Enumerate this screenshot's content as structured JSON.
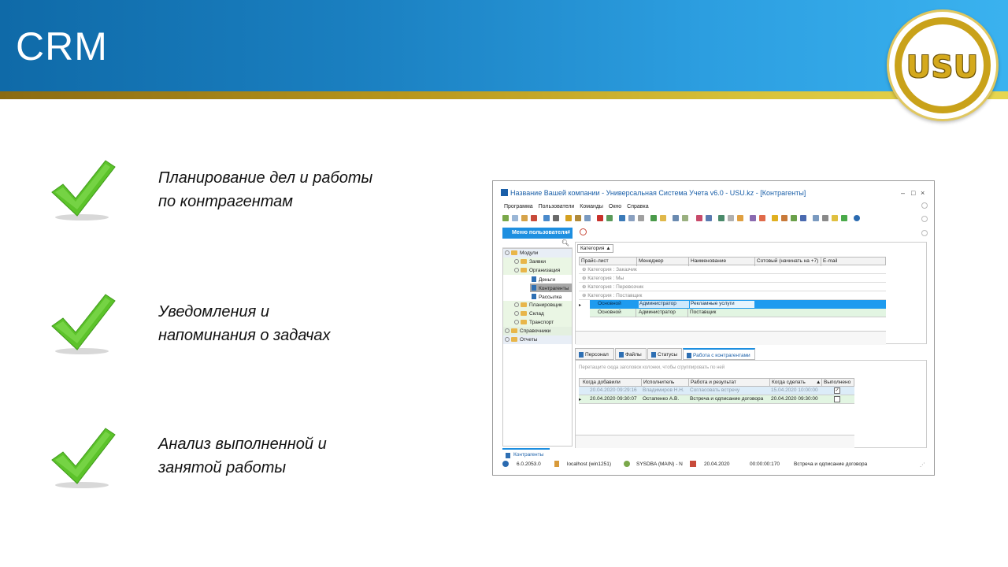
{
  "slide": {
    "title": "CRM",
    "logo_text": "USU",
    "features": [
      {
        "line1": "Планирование дел и работы",
        "line2": "по контрагентам"
      },
      {
        "line1": "Уведомления и",
        "line2": "напоминания о задачах"
      },
      {
        "line1": "Анализ выполненной и",
        "line2": "занятой работы"
      }
    ],
    "colors": {
      "header_start": "#0f6aa8",
      "header_end": "#3ab2ef",
      "stripe": "#c9a21a",
      "check": "#5cc32a",
      "logo_gold": "#d4a91c"
    }
  },
  "app": {
    "window_title": "Название Вашей компании - Универсальная Система Учета v6.0 - USU.kz - [Контрагенты]",
    "window_controls": [
      "–",
      "□",
      "×"
    ],
    "menu": [
      "Программа",
      "Пользователи",
      "Команды",
      "Окно",
      "Справка"
    ],
    "sidebar": {
      "header": "Меню пользователя",
      "pin": "#",
      "items": [
        {
          "label": "Модули",
          "level": 0
        },
        {
          "label": "Заявки",
          "level": 1
        },
        {
          "label": "Организация",
          "level": 1
        },
        {
          "label": "Деньги",
          "level": 2
        },
        {
          "label": "Контрагенты",
          "level": 2
        },
        {
          "label": "Рассылка",
          "level": 2
        },
        {
          "label": "Планировщик",
          "level": 1
        },
        {
          "label": "Склад",
          "level": 1
        },
        {
          "label": "Транспорт",
          "level": 1
        },
        {
          "label": "Справочники",
          "level": 0
        },
        {
          "label": "Отчеты",
          "level": 0
        }
      ]
    },
    "group_field": "Категория",
    "grid1": {
      "columns": [
        "Прайс-лист",
        "Менеджер",
        "Наименование",
        "Сотовый (начинать на +7)",
        "E-mail"
      ],
      "groups": [
        "Категория : Заказчик",
        "Категория : Мы",
        "Категория : Перевозчик",
        "Категория : Поставщик"
      ],
      "rows": [
        [
          "Основной",
          "Администратор",
          "Рекламные услуги",
          "",
          ""
        ],
        [
          "Основной",
          "Администратор",
          "Поставщик",
          "",
          ""
        ]
      ]
    },
    "tabs": [
      "Персонал",
      "Файлы",
      "Статусы",
      "Работа с контрагентами"
    ],
    "grid2": {
      "group_hint": "Перетащите сюда заголовок колонки, чтобы сгруппировать по ней",
      "columns": [
        "Когда добавили",
        "Исполнитель",
        "Работа и результат",
        "Когда сделать",
        "Выполнено"
      ],
      "rows": [
        [
          "20.04.2020 09:29:16",
          "Владимиров Н.Н.",
          "Согласовать встречу",
          "15.04.2020 10:00:00",
          "✓"
        ],
        [
          "20.04.2020 09:30:07",
          "Остапенко А.В.",
          "Встреча и одписание договора",
          "20.04.2020 09:30:00",
          ""
        ]
      ]
    },
    "bottom_tab": "Контрагенты",
    "status": {
      "version": "6.0.2053.0",
      "server": "localhost (win1251)",
      "user": "SYSDBA (MAIN) - N",
      "date": "20.04.2020",
      "timer": "00:00:00:170",
      "message": "Встреча и одписание договора"
    }
  }
}
